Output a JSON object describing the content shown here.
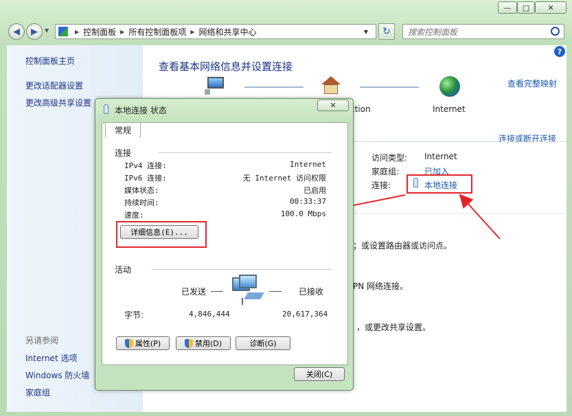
{
  "window": {
    "title": "",
    "minimize_glyph": "—",
    "maximize_glyph": "□",
    "close_glyph": "✕"
  },
  "nav": {
    "back_glyph": "◀",
    "forward_glyph": "▶",
    "dropdown_glyph": "▼",
    "refresh_glyph": "↻",
    "breadcrumb": [
      "控制面板",
      "所有控制面板项",
      "网络和共享中心"
    ],
    "separator": "▶",
    "search_placeholder": "搜索控制面板"
  },
  "sidebar": {
    "items": [
      "控制面板主页",
      "更改适配器设置",
      "更改高级共享设置"
    ],
    "see_also_label": "另请参阅",
    "see_also": [
      "Internet 选项",
      "Windows 防火墙",
      "家庭组"
    ]
  },
  "main": {
    "heading": "查看基本网络信息并设置连接",
    "view_full_map": "查看完整映射",
    "map_internet_label": "Internet",
    "map_connection_label": "ction",
    "connect_disconnect": "连接或断开连接",
    "access_type_label": "访问类型:",
    "access_type_value": "Internet",
    "homegroup_label": "家庭组:",
    "homegroup_value": "已加入",
    "connection_label": "连接:",
    "connection_value": "本地连接",
    "task1_text": "；或设置路由器或访问点。",
    "task2_text": "PN 网络连接。",
    "task3_text": "，或更改共享设置。",
    "help_glyph": "?"
  },
  "dialog": {
    "title": "本地连接 状态",
    "close_glyph": "✕",
    "tab": "常规",
    "section_connection": "连接",
    "rows": [
      {
        "label": "IPv4 连接:",
        "value": "Internet"
      },
      {
        "label": "IPv6 连接:",
        "value": "无 Internet 访问权限"
      },
      {
        "label": "媒体状态:",
        "value": "已启用"
      },
      {
        "label": "持续时间:",
        "value": "00:33:37"
      },
      {
        "label": "速度:",
        "value": "100.0 Mbps"
      }
    ],
    "details_button": "详细信息(E)...",
    "section_activity": "活动",
    "sent_label": "已发送",
    "received_label": "已接收",
    "bytes_label": "字节:",
    "bytes_sent": "4,846,444",
    "bytes_received": "20,617,364",
    "properties_button": "属性(P)",
    "disable_button": "禁用(D)",
    "diagnose_button": "诊断(G)",
    "close_button": "关闭(C)"
  },
  "colors": {
    "annotation_red": "#e0262b",
    "link_blue": "#1c58b0",
    "heading_blue": "#1e3287"
  }
}
